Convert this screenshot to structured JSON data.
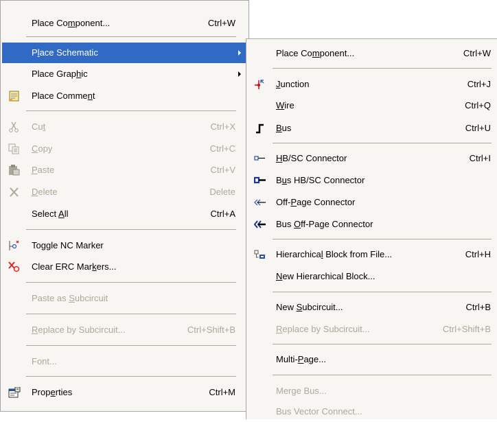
{
  "main_menu": {
    "place_component": {
      "pre": "Place Co",
      "u": "m",
      "post": "ponent...",
      "sc": "Ctrl+W"
    },
    "place_schematic": {
      "pre": "P",
      "u": "l",
      "post": "ace Schematic"
    },
    "place_graphic": {
      "pre": "Place Grap",
      "u": "h",
      "post": "ic"
    },
    "place_comment": {
      "pre": "Place Comme",
      "u": "n",
      "post": "t"
    },
    "cut": {
      "pre": "Cu",
      "u": "t",
      "post": "",
      "sc": "Ctrl+X"
    },
    "copy": {
      "pre": "",
      "u": "C",
      "post": "opy",
      "sc": "Ctrl+C"
    },
    "paste": {
      "pre": "",
      "u": "P",
      "post": "aste",
      "sc": "Ctrl+V"
    },
    "delete": {
      "pre": "",
      "u": "D",
      "post": "elete",
      "sc": "Delete"
    },
    "select_all": {
      "pre": "Select ",
      "u": "A",
      "post": "ll",
      "sc": "Ctrl+A"
    },
    "toggle_nc": {
      "pre": "To",
      "u": "g",
      "post": "gle NC Marker"
    },
    "clear_erc": {
      "pre": "Clear ERC Mar",
      "u": "k",
      "post": "ers..."
    },
    "paste_subcircuit": {
      "pre": "Paste as ",
      "u": "S",
      "post": "ubcircuit"
    },
    "replace_subcircuit": {
      "pre": "",
      "u": "R",
      "post": "eplace by Subcircuit...",
      "sc": "Ctrl+Shift+B"
    },
    "font": {
      "label": "Font..."
    },
    "properties": {
      "pre": "Prop",
      "u": "e",
      "post": "rties",
      "sc": "Ctrl+M"
    }
  },
  "sub_menu": {
    "place_component": {
      "pre": "Place Co",
      "u": "m",
      "post": "ponent...",
      "sc": "Ctrl+W"
    },
    "junction": {
      "pre": "",
      "u": "J",
      "post": "unction",
      "sc": "Ctrl+J"
    },
    "wire": {
      "pre": "",
      "u": "W",
      "post": "ire",
      "sc": "Ctrl+Q"
    },
    "bus": {
      "pre": "",
      "u": "B",
      "post": "us",
      "sc": "Ctrl+U"
    },
    "hbsc_connector": {
      "pre": "",
      "u": "H",
      "post": "B/SC Connector",
      "sc": "Ctrl+I"
    },
    "bus_hbsc_connector": {
      "pre": "B",
      "u": "u",
      "post": "s HB/SC Connector"
    },
    "offpage_connector": {
      "pre": "Off-",
      "u": "P",
      "post": "age Connector"
    },
    "bus_offpage_connector": {
      "pre": "Bus ",
      "u": "O",
      "post": "ff-Page Connector"
    },
    "hier_block_file": {
      "pre": "Hierarchica",
      "u": "l",
      "post": " Block from File...",
      "sc": "Ctrl+H"
    },
    "new_hier_block": {
      "pre": "",
      "u": "N",
      "post": "ew Hierarchical Block..."
    },
    "new_subcircuit": {
      "pre": "New ",
      "u": "S",
      "post": "ubcircuit...",
      "sc": "Ctrl+B"
    },
    "replace_subcircuit": {
      "pre": "",
      "u": "R",
      "post": "eplace by Subcircuit...",
      "sc": "Ctrl+Shift+B"
    },
    "multipage": {
      "pre": "Multi-",
      "u": "P",
      "post": "age..."
    },
    "merge_bus": {
      "pre": "Mer",
      "u": "g",
      "post": "e Bus..."
    },
    "bus_vector_connect": {
      "label": "Bus Vector Connect..."
    }
  },
  "colors": {
    "highlight": "#316ac5",
    "menu_bg": "#f7f6f2",
    "disabled_text": "#aca899"
  }
}
